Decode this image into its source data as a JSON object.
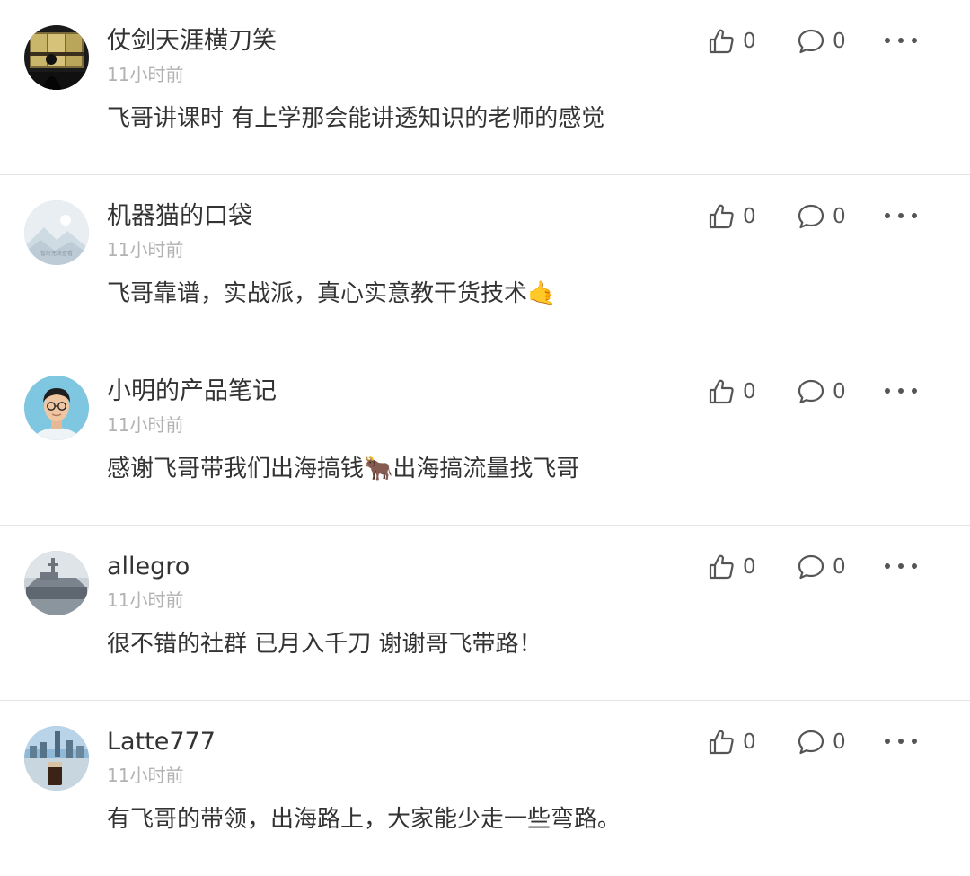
{
  "comments": [
    {
      "username": "仗剑天涯横刀笑",
      "time": "11小时前",
      "text": "飞哥讲课时 有上学那会能讲透知识的老师的感觉",
      "emoji": "",
      "text_after": "",
      "likes": "0",
      "replies": "0",
      "avatar": "dark-window-silhouette"
    },
    {
      "username": "机器猫的口袋",
      "time": "11小时前",
      "text": "飞哥靠谱，实战派，真心实意教干货技术",
      "emoji": "🤙",
      "text_after": "",
      "likes": "0",
      "replies": "0",
      "avatar": "placeholder-landscape",
      "avatar_caption": "暂时无法查看"
    },
    {
      "username": "小明的产品笔记",
      "time": "11小时前",
      "text": "感谢飞哥带我们出海搞钱",
      "emoji": "🐂",
      "text_after": "出海搞流量找飞哥",
      "likes": "0",
      "replies": "0",
      "avatar": "man-with-glasses"
    },
    {
      "username": "allegro",
      "time": "11小时前",
      "text": "很不错的社群 已月入千刀 谢谢哥飞带路！",
      "emoji": "",
      "text_after": "",
      "likes": "0",
      "replies": "0",
      "avatar": "warship-gray"
    },
    {
      "username": "Latte777",
      "time": "11小时前",
      "text": "有飞哥的带领，出海路上，大家能少走一些弯路。",
      "emoji": "",
      "text_after": "",
      "likes": "0",
      "replies": "0",
      "avatar": "city-skyline-drink"
    }
  ],
  "colors": {
    "username": "#333333",
    "time": "#b2b2b2",
    "icon": "#555555",
    "divider": "#e4e4e4"
  },
  "icons": {
    "like": "thumbs-up-icon",
    "reply": "speech-bubble-icon",
    "more": "more-dots-icon"
  }
}
